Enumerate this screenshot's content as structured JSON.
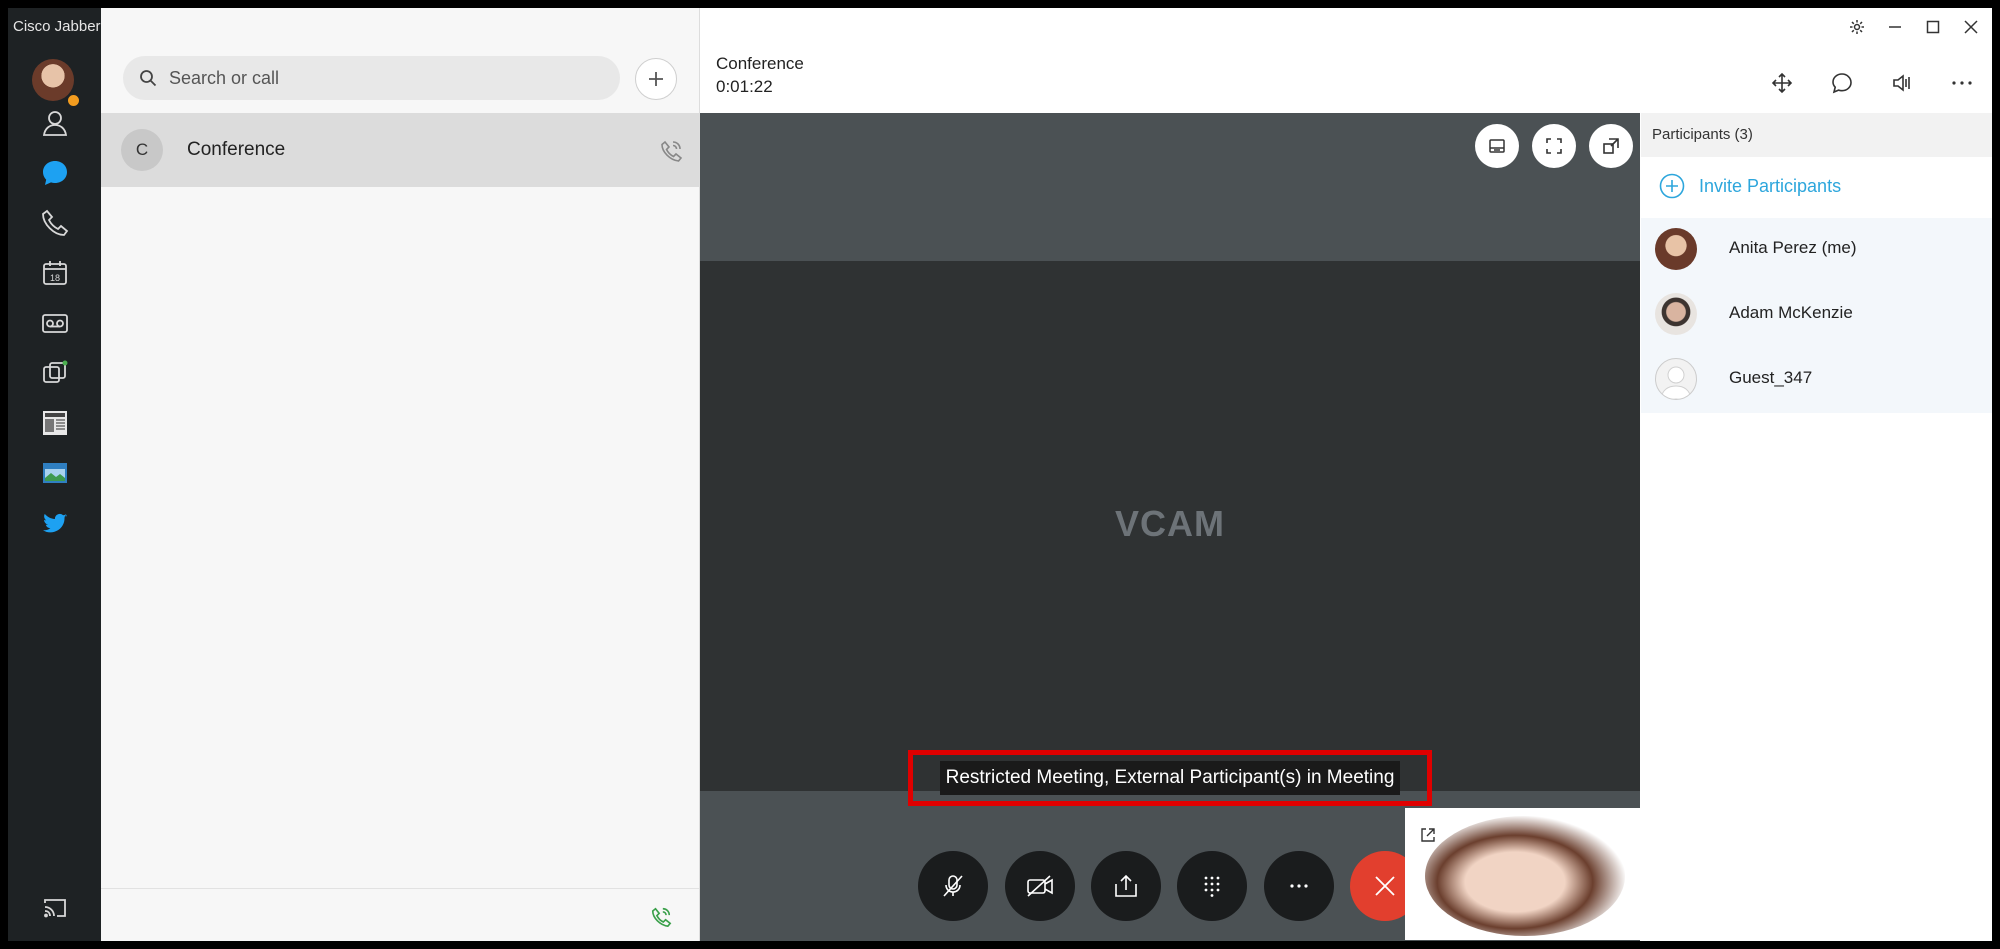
{
  "app": {
    "title": "Cisco Jabber"
  },
  "contacts": {
    "search_placeholder": "Search or call",
    "conversation": {
      "initial": "C",
      "name": "Conference"
    }
  },
  "call": {
    "title": "Conference",
    "timer": "0:01:22",
    "video_watermark": "VCAM",
    "banner": "Restricted Meeting, External Participant(s) in Meeting"
  },
  "participants": {
    "header": "Participants (3)",
    "invite_label": "Invite Participants",
    "list": [
      {
        "name": "Anita Perez (me)"
      },
      {
        "name": "Adam McKenzie"
      },
      {
        "name": "Guest_347"
      }
    ]
  },
  "colors": {
    "accent": "#2da6dc",
    "end_call": "#e23f2e",
    "highlight": "#e00000",
    "presence_away": "#f29c1f"
  }
}
